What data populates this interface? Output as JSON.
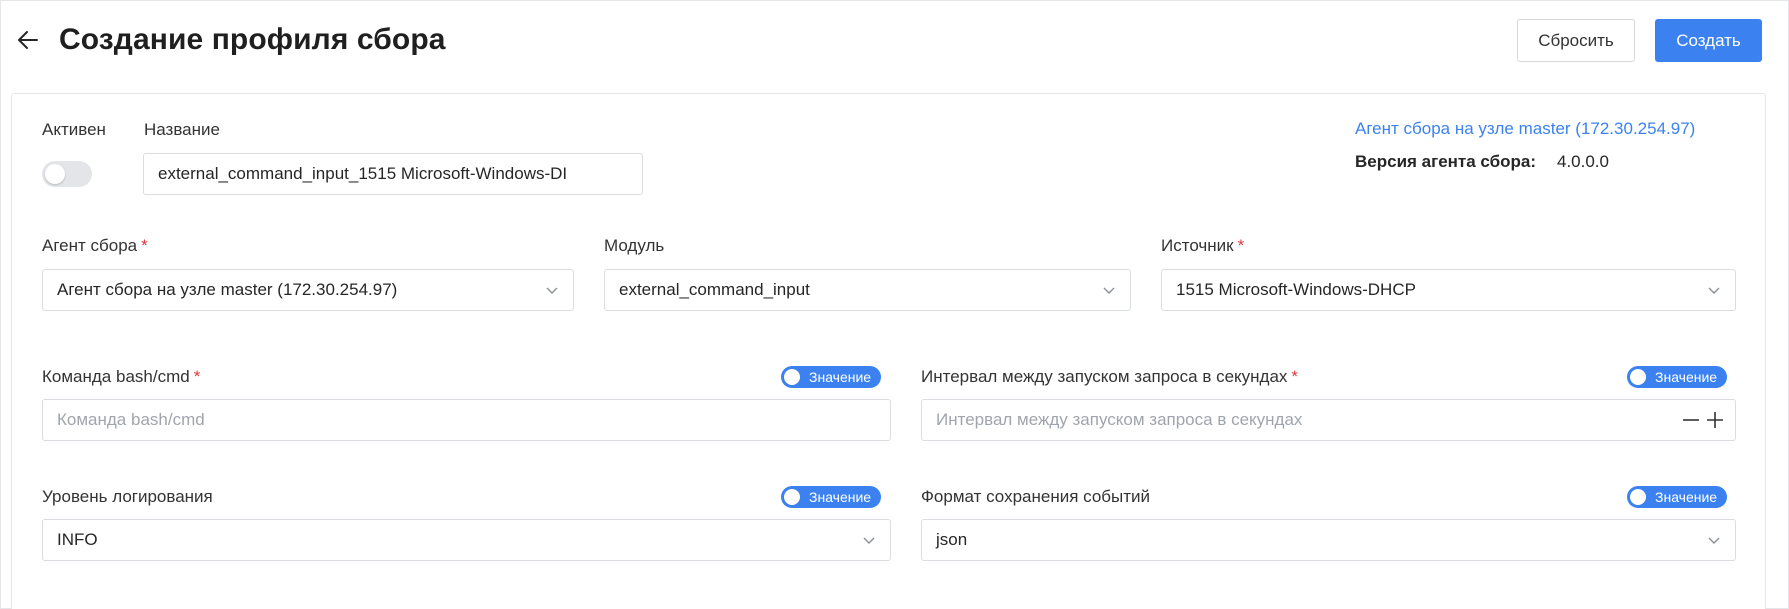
{
  "header": {
    "title": "Создание профиля сбора",
    "reset_label": "Сбросить",
    "create_label": "Создать"
  },
  "form": {
    "active_label": "Активен",
    "active": false,
    "name_label": "Название",
    "name_value": "external_command_input_1515 Microsoft-Windows-DI",
    "agent_info": {
      "link_text": "Агент сбора на узле master (172.30.254.97)",
      "version_label": "Версия агента сбора:",
      "version_value": "4.0.0.0"
    },
    "agent_label": "Агент сбора",
    "agent_value": "Агент сбора на узле master (172.30.254.97)",
    "module_label": "Модуль",
    "module_value": "external_command_input",
    "source_label": "Источник",
    "source_value": "1515 Microsoft-Windows-DHCP",
    "command_label": "Команда bash/cmd",
    "command_placeholder": "Команда bash/cmd",
    "interval_label": "Интервал между запуском запроса в секундах",
    "interval_placeholder": "Интервал между запуском запроса в секундах",
    "log_level_label": "Уровень логирования",
    "log_level_value": "INFO",
    "format_label": "Формат сохранения событий",
    "format_value": "json",
    "value_toggle_label": "Значение",
    "required_mark": "*"
  },
  "colors": {
    "accent": "#3b82f0",
    "required": "#e0383b",
    "border": "#d9dce1"
  }
}
